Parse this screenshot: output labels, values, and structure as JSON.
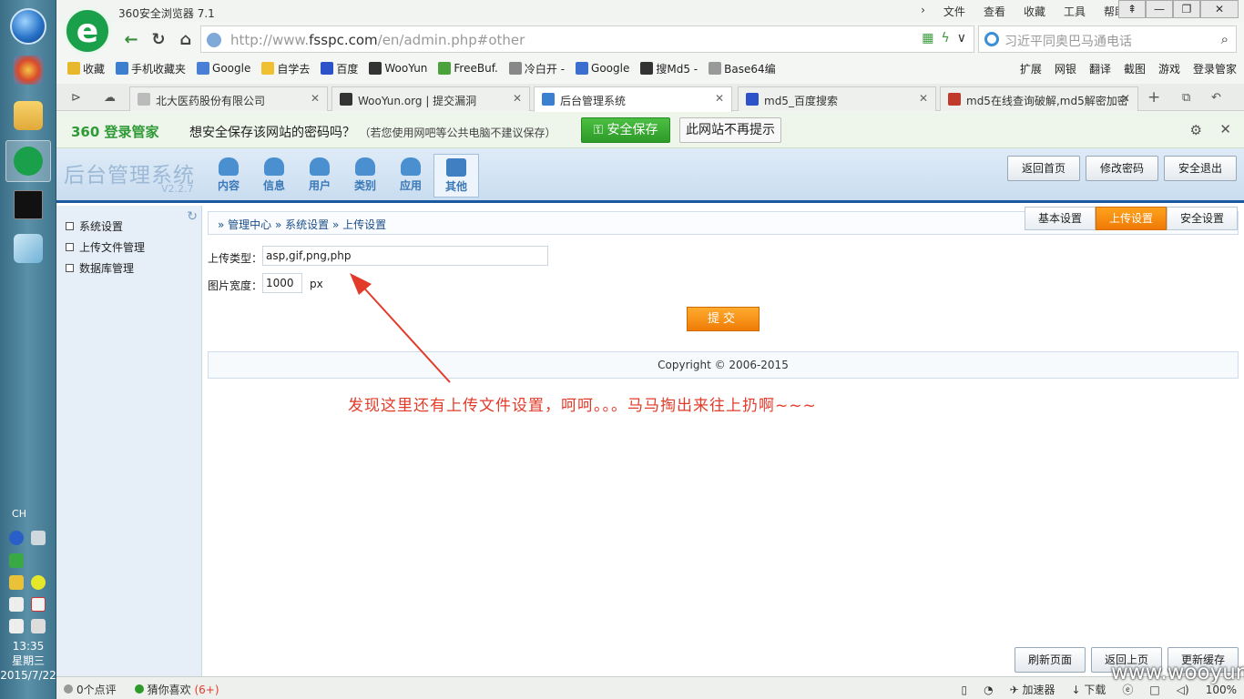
{
  "taskbar": {
    "tray_lang": "CH",
    "clock_time": "13:35",
    "clock_day": "星期三",
    "clock_date": "2015/7/22"
  },
  "browser": {
    "window_title": "360安全浏览器 7.1",
    "menu": [
      "文件",
      "查看",
      "收藏",
      "工具",
      "帮助"
    ],
    "window_controls": [
      "⇞",
      "—",
      "❐",
      "✕"
    ],
    "address": {
      "prefix": "http://www.",
      "domain": "fsspc.com",
      "path": "/en/admin.php#other"
    },
    "search_placeholder": "习近平同奥巴马通电话",
    "bookmarks": [
      {
        "label": "收藏",
        "icon": "star-icon",
        "color": "#e8b82c"
      },
      {
        "label": "手机收藏夹",
        "icon": "phone-icon",
        "color": "#3b7fd0"
      },
      {
        "label": "Google",
        "icon": "google-icon",
        "color": "#4a7fd6"
      },
      {
        "label": "自学去",
        "icon": "bulb-icon",
        "color": "#f0c030"
      },
      {
        "label": "百度",
        "icon": "baidu-icon",
        "color": "#2b52c8"
      },
      {
        "label": "WooYun",
        "icon": "wooyun-icon",
        "color": "#333333"
      },
      {
        "label": "FreeBuf.",
        "icon": "freebuf-icon",
        "color": "#4aa33a"
      },
      {
        "label": "冷白开 -",
        "icon": "star-outline-icon",
        "color": "#888888"
      },
      {
        "label": "Google",
        "icon": "google-icon",
        "color": "#3a6fd0"
      },
      {
        "label": "搜Md5 -",
        "icon": "md5-icon",
        "color": "#333333"
      },
      {
        "label": "Base64编",
        "icon": "doc-icon",
        "color": "#999999"
      }
    ],
    "bookmarks_right": [
      "扩展",
      "网银",
      "翻译",
      "截图",
      "游戏",
      "登录管家"
    ],
    "tabs": [
      {
        "label": "北大医药股份有限公司",
        "color": "#bbbbbb"
      },
      {
        "label": "WooYun.org | 提交漏洞",
        "color": "#333333"
      },
      {
        "label": "后台管理系统",
        "color": "#3b7fd0"
      },
      {
        "label": "md5_百度搜索",
        "color": "#2b52c8"
      },
      {
        "label": "md5在线查询破解,md5解密加密",
        "color": "#c0392b"
      }
    ],
    "tab_add": "+",
    "password_bar": {
      "logo": "360 登录管家",
      "message": "想安全保存该网站的密码吗？",
      "hint": "（若您使用网吧等公共电脑不建议保存）",
      "save_label": "安全保存",
      "never_label": "此网站不再提示"
    }
  },
  "admin": {
    "title": "后台管理系统",
    "version": "V2.2.7",
    "nav": [
      {
        "label": "内容",
        "icon": "chat-icon"
      },
      {
        "label": "信息",
        "icon": "user-icon"
      },
      {
        "label": "用户",
        "icon": "users-icon"
      },
      {
        "label": "类别",
        "icon": "star-icon"
      },
      {
        "label": "应用",
        "icon": "cloud-icon"
      },
      {
        "label": "其他",
        "icon": "wrench-icon"
      }
    ],
    "top_buttons": [
      "返回首页",
      "修改密码",
      "安全退出"
    ],
    "sidebar": [
      "系统设置",
      "上传文件管理",
      "数据库管理"
    ],
    "breadcrumb": "»  管理中心   »  系统设置   »  上传设置",
    "settings_tabs": [
      "基本设置",
      "上传设置",
      "安全设置"
    ],
    "form": {
      "upload_type_label": "上传类型：",
      "upload_type_value": "asp,gif,png,php",
      "image_width_label": "图片宽度：",
      "image_width_value": "1000",
      "image_width_unit": "px",
      "submit_label": "提交"
    },
    "copyright": "Copyright © 2006-2015",
    "annotation": "发现这里还有上传文件设置，呵呵。。。马马掏出来往上扔啊~~~",
    "bottom_buttons": [
      "刷新页面",
      "返回上页",
      "更新缓存"
    ]
  },
  "statusbar": {
    "comments": "0个点评",
    "likes": "猜你喜欢",
    "likes_count": "(6+)",
    "accelerator": "加速器",
    "download": "下载",
    "zoom": "100%"
  },
  "watermark": "www.wooyun.org",
  "colors": {
    "accent_green": "#2e9a29",
    "accent_orange": "#ef7c06",
    "admin_blue": "#1b5aa0",
    "annotation_red": "#e23b2a"
  }
}
